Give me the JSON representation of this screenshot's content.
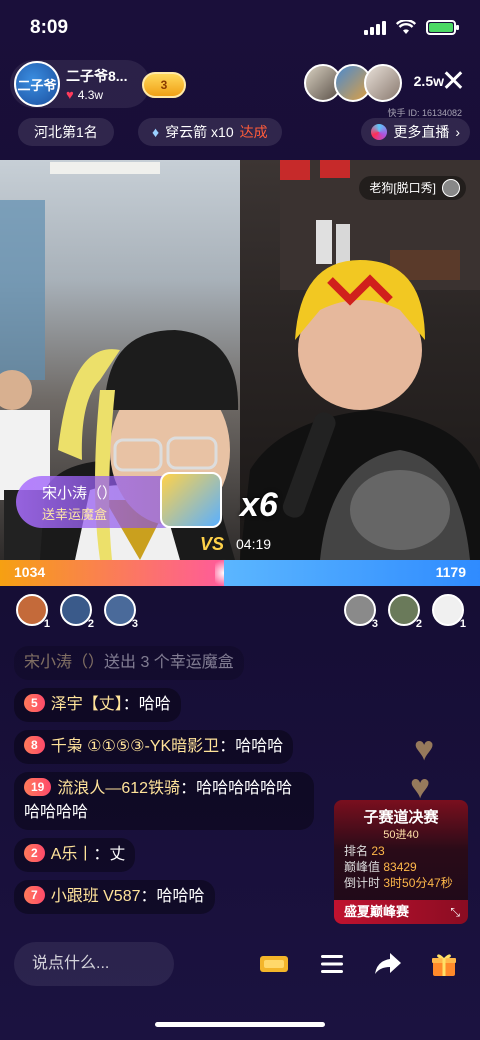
{
  "status_bar": {
    "time": "8:09"
  },
  "header": {
    "host_avatar_text": "二子爷",
    "host_name": "二子爷8...",
    "host_likes": "4.3w",
    "level": "3",
    "viewer_count": "2.5w",
    "kuaishou_id": "快手 ID: 16134082"
  },
  "tags": {
    "rank": "河北第1名",
    "task_label": "穿云箭 x10",
    "task_status": "达成",
    "more": "更多直播"
  },
  "video": {
    "guest_name": "老狗[脱口秀]",
    "gift_sender": "宋小涛（）",
    "gift_desc": "送幸运魔盒",
    "gift_count": "x6",
    "vs": "VS",
    "timer": "04:19"
  },
  "pk": {
    "left_score": "1034",
    "right_score": "1179",
    "left_fraction": 0.467
  },
  "contributors": {
    "left": [
      {
        "rank": "1",
        "color": "#c46a3a"
      },
      {
        "rank": "2",
        "color": "#3a5a8a"
      },
      {
        "rank": "3",
        "color": "#4a6a9a"
      }
    ],
    "right": [
      {
        "rank": "3",
        "color": "#8a8a8a"
      },
      {
        "rank": "2",
        "color": "#6a7a5a"
      },
      {
        "rank": "1",
        "color": "#f0f0f0"
      }
    ]
  },
  "chat": [
    {
      "level": "",
      "name": "宋小涛（）",
      "text": "送出 3 个幸运魔盒",
      "faded": true
    },
    {
      "level": "5",
      "name": "泽宇【丈】",
      "text": "：哈哈"
    },
    {
      "level": "8",
      "name": "千枭 ①①⑤③-YK暗影卫",
      "text": "：哈哈哈"
    },
    {
      "level": "19",
      "name": "流浪人—612铁骑",
      "text": "：哈哈哈哈哈哈哈哈哈哈"
    },
    {
      "level": "2",
      "name": "A乐丨",
      "text": "：丈"
    },
    {
      "level": "7",
      "name": "小跟班 V587",
      "text": "：哈哈哈"
    }
  ],
  "event": {
    "title": "子赛道决赛",
    "subtitle": "50进40",
    "rank_label": "排名",
    "rank_value": "23",
    "peak_label": "巅峰值",
    "peak_value": "83429",
    "countdown_label": "倒计时",
    "countdown_value": "3时50分47秒",
    "footer": "盛夏巅峰赛"
  },
  "bottom": {
    "input_placeholder": "说点什么..."
  }
}
